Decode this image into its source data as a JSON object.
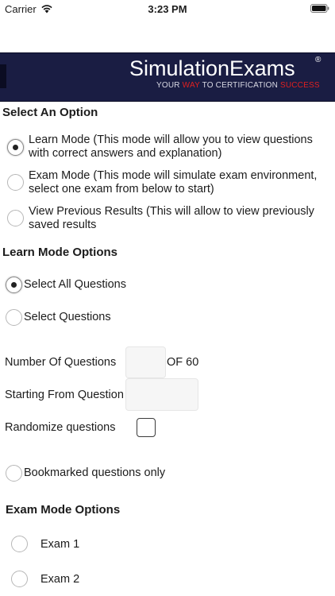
{
  "status_bar": {
    "carrier": "Carrier",
    "time": "3:23 PM"
  },
  "banner": {
    "brand": "SimulationExams",
    "registered": "®",
    "tagline_parts": [
      "YOUR ",
      "WAY",
      " TO CERTIFICATION ",
      "SUCCESS"
    ],
    "colors": {
      "background": "#1a1d43",
      "accent": "#e02020"
    }
  },
  "select_option": {
    "heading": "Select An Option",
    "options": [
      {
        "label": "Learn Mode (This mode will allow you to view questions with correct answers and explanation)",
        "selected": true
      },
      {
        "label": "Exam Mode (This mode will simulate exam environment, select one exam from below to start)",
        "selected": false
      },
      {
        "label": "View Previous Results (This will allow to view previously saved results",
        "selected": false
      }
    ]
  },
  "learn_mode": {
    "heading": "Learn Mode Options",
    "select_all": {
      "label": "Select All Questions",
      "selected": true
    },
    "select_questions": {
      "label": "Select Questions",
      "selected": false
    },
    "number_of_questions": {
      "label": "Number Of Questions",
      "value": "",
      "total": "OF 60"
    },
    "starting_from": {
      "label": "Starting From Question",
      "value": ""
    },
    "randomize": {
      "label": "Randomize questions",
      "checked": false
    },
    "bookmarked": {
      "label": "Bookmarked questions only",
      "selected": false
    }
  },
  "exam_mode": {
    "heading": "Exam Mode Options",
    "exams": [
      {
        "label": "Exam 1",
        "selected": false
      },
      {
        "label": "Exam 2",
        "selected": false
      }
    ]
  }
}
